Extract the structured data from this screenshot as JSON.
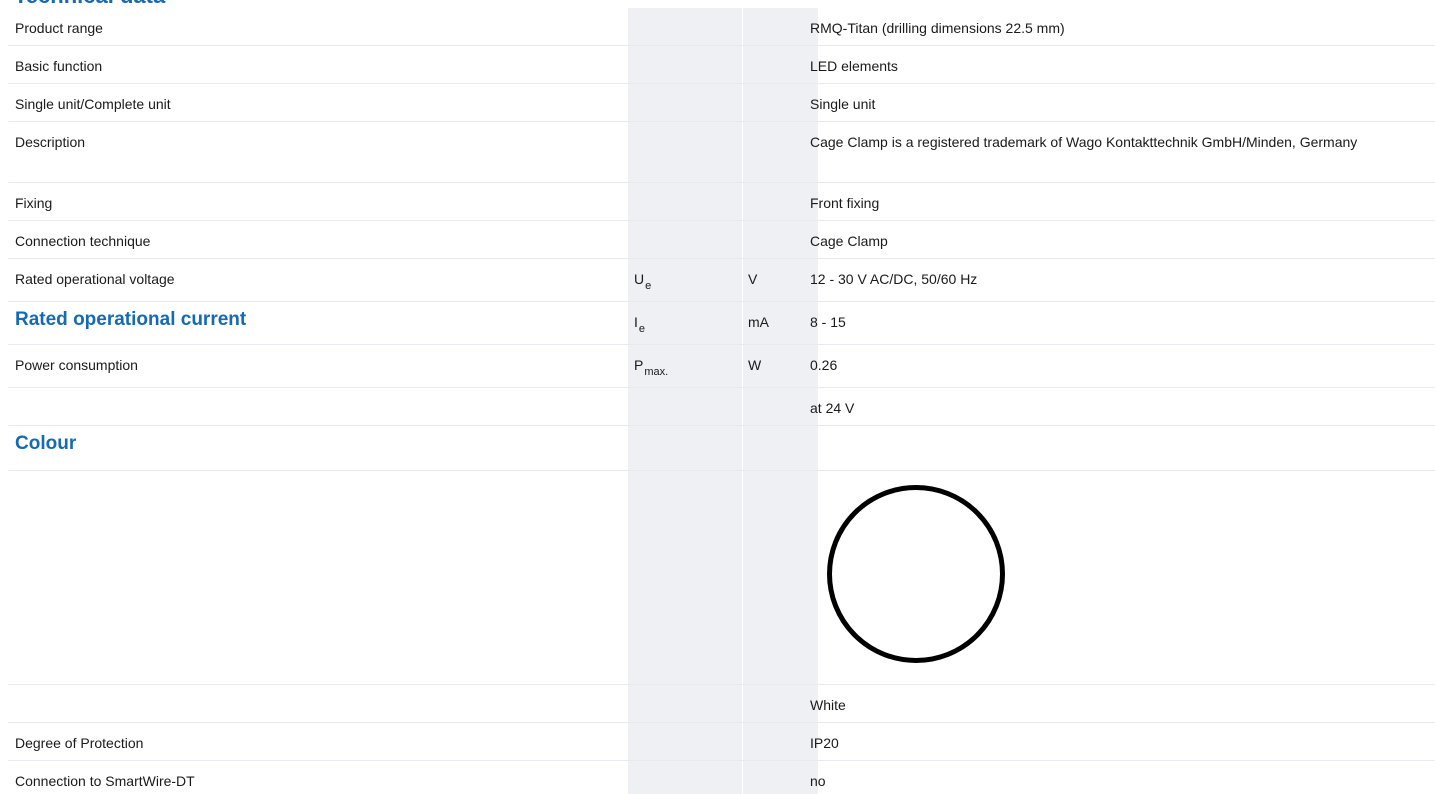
{
  "page": {
    "cut_heading": "Technical data"
  },
  "rows": [
    {
      "label": "Product range",
      "value": "RMQ-Titan (drilling dimensions 22.5 mm)"
    },
    {
      "label": "Basic function",
      "value": "LED elements"
    },
    {
      "label": "Single unit/Complete unit",
      "value": "Single unit"
    },
    {
      "label": "Description",
      "value": "Cage Clamp is a registered trademark of Wago Kontakttechnik GmbH/Minden, Germany"
    },
    {
      "label": "Fixing",
      "value": "Front fixing"
    },
    {
      "label": "Connection technique",
      "value": "Cage Clamp"
    },
    {
      "label": "Rated operational voltage",
      "symbol_main": "U",
      "symbol_sub": "e",
      "unit": "V",
      "value": "12 - 30 V AC/DC, 50/60 Hz"
    },
    {
      "label": "Rated operational current",
      "symbol_main": "I",
      "symbol_sub": "e",
      "unit": "mA",
      "value": "8 - 15"
    },
    {
      "label": "Power consumption",
      "symbol_main": "P",
      "symbol_sub": "max.",
      "unit": "W",
      "value": "0.26"
    },
    {
      "label": "",
      "value": "at 24 V"
    },
    {
      "label": "Colour",
      "value": ""
    },
    {
      "label": "",
      "value": ""
    },
    {
      "label": "",
      "value": "White"
    },
    {
      "label": "Degree of Protection",
      "value": "IP20"
    },
    {
      "label": "Connection to SmartWire-DT",
      "value": "no"
    }
  ],
  "colour_swatch": {
    "name": "White",
    "fill": "#ffffff",
    "outline": "#000000"
  },
  "colors": {
    "heading_blue": "#1569b5",
    "shade": "#eef0f4",
    "row_border": "#e7e9ee"
  }
}
